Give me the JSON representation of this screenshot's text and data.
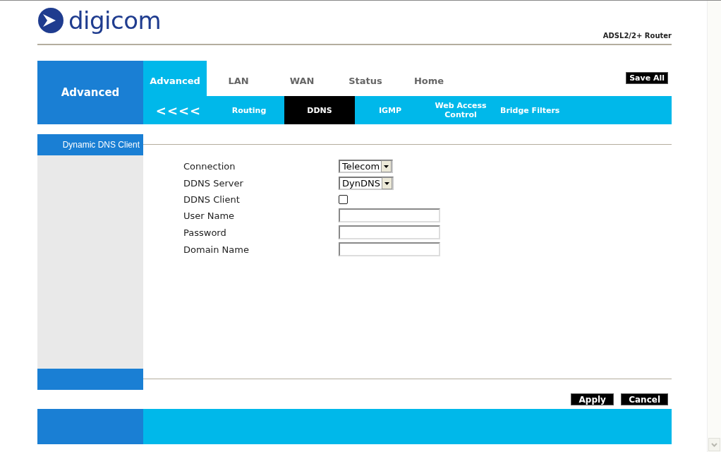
{
  "header": {
    "logo_text": "digicom",
    "product": "ADSL2/2+ Router"
  },
  "nav": {
    "section_title": "Advanced",
    "tabs": [
      {
        "label": "Advanced",
        "selected": true
      },
      {
        "label": "LAN",
        "selected": false
      },
      {
        "label": "WAN",
        "selected": false
      },
      {
        "label": "Status",
        "selected": false
      },
      {
        "label": "Home",
        "selected": false
      }
    ],
    "save_all": "Save All",
    "back": "<<<<",
    "subtabs": [
      {
        "label": "Routing",
        "selected": false
      },
      {
        "label": "DDNS",
        "selected": true
      },
      {
        "label": "IGMP",
        "selected": false
      },
      {
        "label": "Web Access Control",
        "selected": false
      },
      {
        "label": "Bridge Filters",
        "selected": false
      }
    ]
  },
  "sidebar": {
    "items": [
      {
        "label": "Dynamic DNS Client",
        "selected": true
      }
    ]
  },
  "form": [
    {
      "kind": "select",
      "label": "Connection",
      "value": "Telecom"
    },
    {
      "kind": "select",
      "label": "DDNS Server",
      "value": "DynDNS"
    },
    {
      "kind": "checkbox",
      "label": "DDNS Client",
      "checked": false
    },
    {
      "kind": "text",
      "label": "User Name"
    },
    {
      "kind": "text",
      "label": "Password"
    },
    {
      "kind": "text",
      "label": "Domain Name"
    }
  ],
  "buttons": [
    "Apply",
    "Cancel"
  ]
}
